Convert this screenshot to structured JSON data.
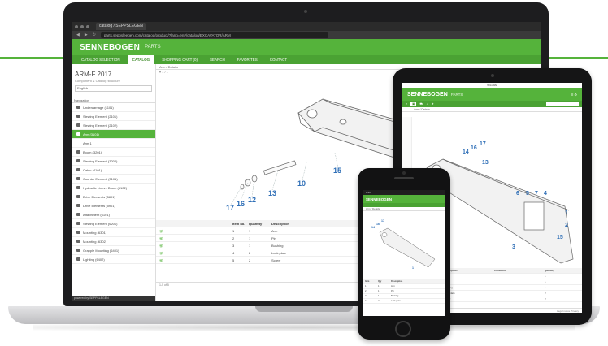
{
  "browser": {
    "tab_title": "catalog / SEPPSLEGEN",
    "url": "parts.seppsleegen.com/catalog/product/?lang=en#/catalog/EXCAVATOR/ARM"
  },
  "app": {
    "brand": "SENNEBOGEN",
    "product": "PARTS",
    "nav": [
      {
        "label": "CATALOG SELECTION",
        "active": false
      },
      {
        "label": "CATALOG",
        "active": true
      },
      {
        "label": "SHOPPING CART (0)",
        "active": false
      },
      {
        "label": "SEARCH",
        "active": false
      },
      {
        "label": "FAVORITES",
        "active": false
      },
      {
        "label": "CONTACT",
        "active": false
      }
    ]
  },
  "sidebar": {
    "title": "ARM-F 2017",
    "subtitle": "Component & Catalog structure",
    "language": "English",
    "nav_header": "Navigation",
    "items": [
      {
        "label": "Undercarriage (1101)",
        "active": false,
        "sub": false
      },
      {
        "label": "Slewing Element (2101)",
        "active": false,
        "sub": false
      },
      {
        "label": "Slewing Element (2102)",
        "active": false,
        "sub": false
      },
      {
        "label": "Arm (3101)",
        "active": true,
        "sub": false
      },
      {
        "label": "Arm 1",
        "active": false,
        "sub": true
      },
      {
        "label": "Boom (3201)",
        "active": false,
        "sub": false
      },
      {
        "label": "Slewing Element (3202)",
        "active": false,
        "sub": false
      },
      {
        "label": "Cabin (4101)",
        "active": false,
        "sub": false
      },
      {
        "label": "Counter Element (5101)",
        "active": false,
        "sub": false
      },
      {
        "label": "Hydraulic Lines - Boom (5102)",
        "active": false,
        "sub": false
      },
      {
        "label": "Drive Elements (5801)",
        "active": false,
        "sub": false
      },
      {
        "label": "Drive Elements (5901)",
        "active": false,
        "sub": false
      },
      {
        "label": "Attachment (6101)",
        "active": false,
        "sub": false
      },
      {
        "label": "Slewing Element (6201)",
        "active": false,
        "sub": false
      },
      {
        "label": "Mounting (6301)",
        "active": false,
        "sub": false
      },
      {
        "label": "Mounting (6302)",
        "active": false,
        "sub": false
      },
      {
        "label": "Grapple Mounting (6401)",
        "active": false,
        "sub": false
      },
      {
        "label": "Lighting (6402)",
        "active": false,
        "sub": false
      }
    ],
    "footer": "powered by SEPPSLEGEN"
  },
  "content": {
    "header": "Arm / Details",
    "toolbar": "▾ 1 / 1",
    "table_headers": [
      "",
      "Item no.",
      "Quantity",
      "Description"
    ],
    "rows": [
      [
        "",
        "1",
        "1",
        "Arm"
      ],
      [
        "",
        "2",
        "1",
        "Pin"
      ],
      [
        "",
        "3",
        "1",
        "Bushing"
      ],
      [
        "",
        "4",
        "2",
        "Lock plate"
      ],
      [
        "",
        "5",
        "2",
        "Screw"
      ]
    ],
    "footer": "1-5 of 5"
  },
  "callouts": [
    "1",
    "10",
    "12",
    "13",
    "14",
    "15",
    "16",
    "17"
  ],
  "tablet": {
    "status": "9:41 AM",
    "brand": "SENNEBOGEN",
    "product": "PARTS",
    "header": "Arm / Details",
    "callouts": [
      "1",
      "2",
      "3",
      "4",
      "5",
      "6",
      "7",
      "13",
      "14",
      "15",
      "16",
      "17"
    ],
    "table_headers": [
      "Item",
      "Description",
      "Comment",
      "Quantity"
    ],
    "rows": [
      [
        "1",
        "Arm",
        "",
        "1"
      ],
      [
        "2",
        "Pin",
        "",
        "1"
      ],
      [
        "3",
        "Bushing",
        "",
        "1"
      ],
      [
        "4",
        "Lock plate",
        "",
        "2"
      ],
      [
        "5",
        "Screw",
        "",
        "2"
      ]
    ],
    "footer": "Legal notice   Privacy"
  },
  "phone": {
    "status": "9:41",
    "brand": "SENNEBOGEN",
    "header": "Arm / Details",
    "table_headers": [
      "Item",
      "Qty",
      "Description"
    ],
    "rows": [
      [
        "1",
        "1",
        "Arm"
      ],
      [
        "2",
        "1",
        "Pin"
      ],
      [
        "3",
        "1",
        "Bushing"
      ],
      [
        "4",
        "2",
        "Lock plate"
      ]
    ]
  },
  "colors": {
    "brand_green": "#55b33b",
    "nav_green": "#4aa233",
    "device_black": "#1d1d1f",
    "callout_blue": "#2f6fb7"
  }
}
